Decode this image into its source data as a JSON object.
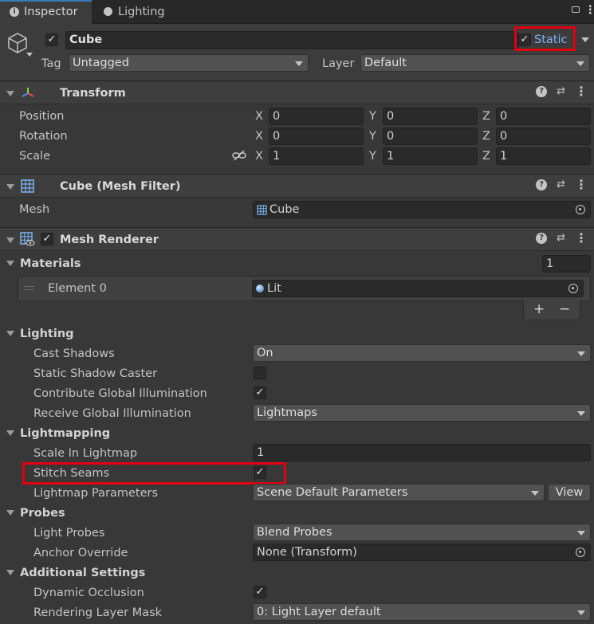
{
  "tabs": [
    {
      "label": "Inspector"
    },
    {
      "label": "Lighting"
    }
  ],
  "object": {
    "name": "Cube",
    "static_label": "Static",
    "tag_label": "Tag",
    "tag_value": "Untagged",
    "layer_label": "Layer",
    "layer_value": "Default"
  },
  "transform": {
    "title": "Transform",
    "rows": [
      {
        "label": "Position",
        "x": "0",
        "y": "0",
        "z": "0"
      },
      {
        "label": "Rotation",
        "x": "0",
        "y": "0",
        "z": "0"
      },
      {
        "label": "Scale",
        "x": "1",
        "y": "1",
        "z": "1"
      }
    ],
    "axes": {
      "x": "X",
      "y": "Y",
      "z": "Z"
    }
  },
  "mesh_filter": {
    "title": "Cube (Mesh Filter)",
    "mesh_label": "Mesh",
    "mesh_value": "Cube"
  },
  "mesh_renderer": {
    "title": "Mesh Renderer",
    "materials_label": "Materials",
    "materials_count": "1",
    "element_label": "Element 0",
    "element_value": "Lit",
    "add_label": "+",
    "remove_label": "−",
    "lighting": {
      "label": "Lighting",
      "cast_shadows_label": "Cast Shadows",
      "cast_shadows_value": "On",
      "static_shadow_caster_label": "Static Shadow Caster",
      "contribute_gi_label": "Contribute Global Illumination",
      "receive_gi_label": "Receive Global Illumination",
      "receive_gi_value": "Lightmaps"
    },
    "lightmapping": {
      "label": "Lightmapping",
      "scale_label": "Scale In Lightmap",
      "scale_value": "1",
      "stitch_label": "Stitch Seams",
      "params_label": "Lightmap Parameters",
      "params_value": "Scene Default Parameters",
      "view_label": "View"
    },
    "probes": {
      "label": "Probes",
      "light_probes_label": "Light Probes",
      "light_probes_value": "Blend Probes",
      "anchor_label": "Anchor Override",
      "anchor_value": "None (Transform)"
    },
    "additional": {
      "label": "Additional Settings",
      "dynamic_occlusion_label": "Dynamic Occlusion",
      "rendering_layer_label": "Rendering Layer Mask",
      "rendering_layer_value": "0: Light Layer default"
    }
  },
  "checked_glyph": "✓",
  "colors": {
    "highlight": "#e0000f",
    "panel": "#383838",
    "header": "#3e3e3e"
  }
}
